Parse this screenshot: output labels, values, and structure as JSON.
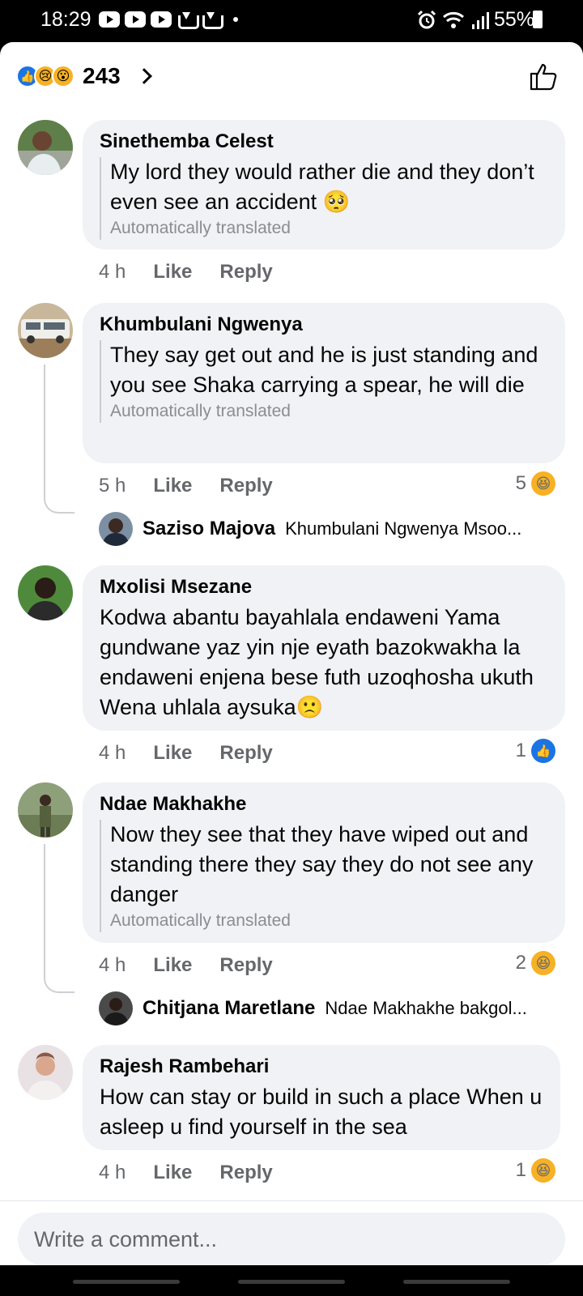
{
  "status_bar": {
    "time": "18:29",
    "battery": "55%"
  },
  "header": {
    "reactions": [
      "like-icon",
      "sad-icon",
      "wow-icon"
    ],
    "reaction_count": "243"
  },
  "comments": [
    {
      "author": "Sinethemba Celest",
      "text": "My lord they would rather die and they don’t even see an accident",
      "emoji": "🥺",
      "auto_translated": "Automatically translated",
      "time": "4 h",
      "like": "Like",
      "reply": "Reply"
    },
    {
      "author": "Khumbulani Ngwenya",
      "text": "They say get out and he is just standing and you see Shaka carrying a spear, he will die",
      "auto_translated": "Automatically translated",
      "time": "5 h",
      "like": "Like",
      "reply": "Reply",
      "reaction_count": "5",
      "reaction_icon": "haha-icon",
      "reply_preview": {
        "author": "Saziso Majova",
        "text": "Khumbulani Ngwenya Msoo..."
      }
    },
    {
      "author": "Mxolisi Msezane",
      "text": "Kodwa abantu bayahlala endaweni Yama gundwane yaz yin nje eyath bazokwakha la endaweni enjena bese futh uzoqhosha ukuth Wena uhlala aysuka",
      "emoji": "🙁",
      "time": "4 h",
      "like": "Like",
      "reply": "Reply",
      "reaction_count": "1",
      "reaction_icon": "like-icon"
    },
    {
      "author": "Ndae Makhakhe",
      "text": "Now they see that they have wiped out and standing there they say they do not see any danger",
      "auto_translated": "Automatically translated",
      "time": "4 h",
      "like": "Like",
      "reply": "Reply",
      "reaction_count": "2",
      "reaction_icon": "haha-icon",
      "reply_preview": {
        "author": "Chitjana Maretlane",
        "text": "Ndae Makhakhe bakgol..."
      }
    },
    {
      "author": "Rajesh Rambehari",
      "text": "How can stay or build in such a place When u asleep u find yourself  in the sea",
      "time": "4 h",
      "like": "Like",
      "reply": "Reply",
      "reaction_count": "1",
      "reaction_icon": "haha-icon"
    }
  ],
  "composer": {
    "placeholder": "Write a comment..."
  }
}
